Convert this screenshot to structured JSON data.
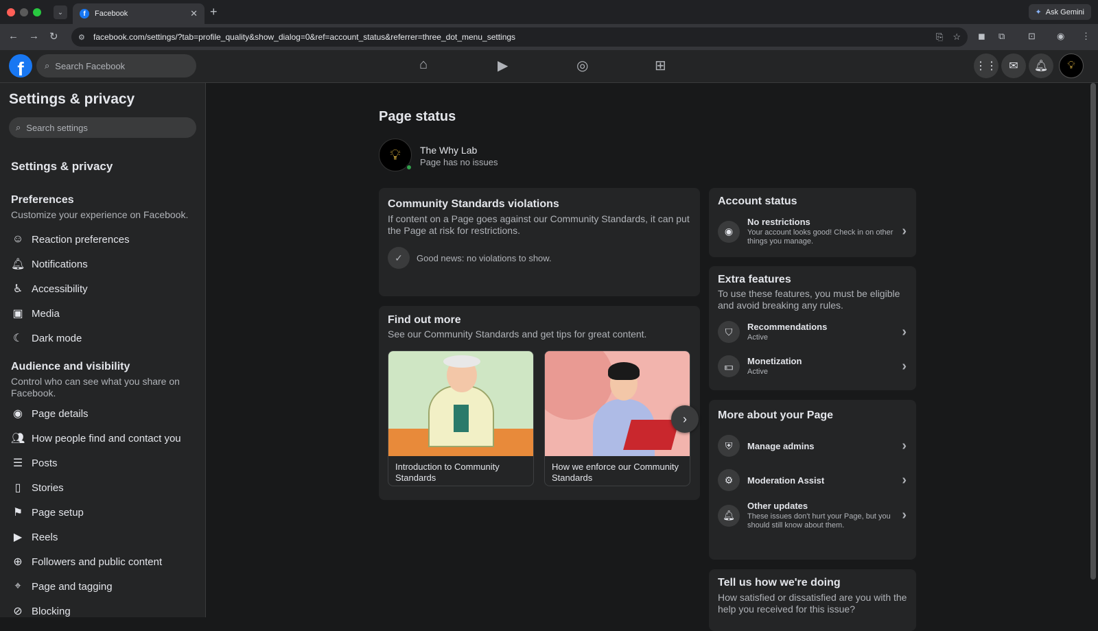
{
  "browser": {
    "tab_title": "Facebook",
    "url": "facebook.com/settings/?tab=profile_quality&show_dialog=0&ref=account_status&referrer=three_dot_menu_settings",
    "ask_gemini": "Ask Gemini"
  },
  "topbar": {
    "search_placeholder": "Search Facebook"
  },
  "sidebar": {
    "title": "Settings & privacy",
    "search_placeholder": "Search settings",
    "section_heading": "Settings & privacy",
    "preferences": {
      "heading": "Preferences",
      "description": "Customize your experience on Facebook.",
      "items": [
        "Reaction preferences",
        "Notifications",
        "Accessibility",
        "Media",
        "Dark mode"
      ]
    },
    "audience": {
      "heading": "Audience and visibility",
      "description": "Control who can see what you share on Facebook.",
      "items": [
        "Page details",
        "How people find and contact you",
        "Posts",
        "Stories",
        "Page setup",
        "Reels",
        "Followers and public content",
        "Page and tagging",
        "Blocking"
      ]
    }
  },
  "main": {
    "title": "Page status",
    "page_name": "The Why Lab",
    "page_status": "Page has no issues",
    "violations": {
      "heading": "Community Standards violations",
      "description": "If content on a Page goes against our Community Standards, it can put the Page at risk for restrictions.",
      "good_news": "Good news: no violations to show."
    },
    "find_out_more": {
      "heading": "Find out more",
      "description": "See our Community Standards and get tips for great content.",
      "cards": [
        "Introduction to Community Standards",
        "How we enforce our Community Standards"
      ]
    },
    "account_status": {
      "heading": "Account status",
      "row_title": "No restrictions",
      "row_desc": "Your account looks good! Check in on other things you manage."
    },
    "extra_features": {
      "heading": "Extra features",
      "description": "To use these features, you must be eligible and avoid breaking any rules.",
      "rows": [
        {
          "title": "Recommendations",
          "sub": "Active"
        },
        {
          "title": "Monetization",
          "sub": "Active"
        }
      ]
    },
    "more_about": {
      "heading": "More about your Page",
      "rows": [
        {
          "title": "Manage admins",
          "sub": ""
        },
        {
          "title": "Moderation Assist",
          "sub": ""
        },
        {
          "title": "Other updates",
          "sub": "These issues don't hurt your Page, but you should still know about them."
        }
      ]
    },
    "feedback": {
      "heading": "Tell us how we're doing",
      "description": "How satisfied or dissatisfied are you with the help you received for this issue?"
    }
  },
  "colors": {
    "accent": "#1877f2",
    "status_green": "#31a24c"
  }
}
